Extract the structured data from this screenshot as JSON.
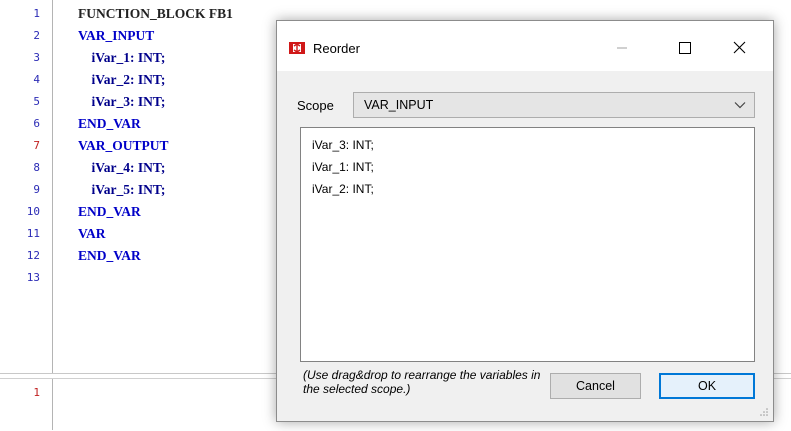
{
  "editor": {
    "line_numbers": [
      "1",
      "2",
      "3",
      "4",
      "5",
      "6",
      "7",
      "8",
      "9",
      "10",
      "11",
      "12",
      "13"
    ],
    "lines": [
      "FUNCTION_BLOCK FB1",
      "VAR_INPUT",
      "    iVar_1: INT;",
      "    iVar_2: INT;",
      "    iVar_3: INT;",
      "END_VAR",
      "VAR_OUTPUT",
      "    iVar_4: INT;",
      "    iVar_5: INT;",
      "END_VAR",
      "VAR",
      "END_VAR",
      ""
    ],
    "lower_line_number": "1"
  },
  "dialog": {
    "title": "Reorder",
    "scope_label": "Scope",
    "scope_value": "VAR_INPUT",
    "variables": [
      "iVar_3: INT;",
      "iVar_1: INT;",
      "iVar_2: INT;"
    ],
    "hint": "(Use drag&drop to rearrange the variables in the selected scope.)",
    "cancel_label": "Cancel",
    "ok_label": "OK"
  },
  "colors": {
    "accent": "#0078d7",
    "keyword": "#0000c8",
    "line_number": "#2b2bb5"
  },
  "icons": [
    "reorder-app-icon",
    "minimize-icon",
    "maximize-icon",
    "close-icon",
    "chevron-down-icon",
    "resize-grip-icon"
  ]
}
